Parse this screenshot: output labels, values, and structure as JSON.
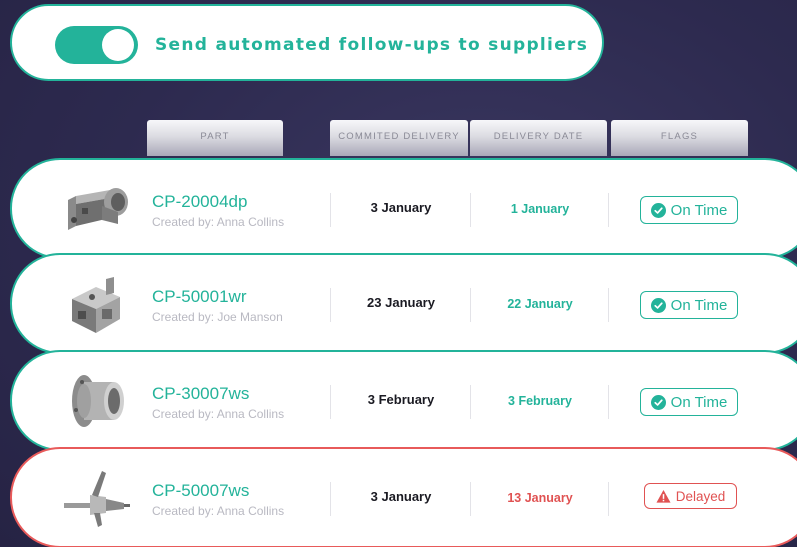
{
  "toggle": {
    "label": "Send automated follow-ups to suppliers",
    "enabled": true
  },
  "table": {
    "headers": [
      "PART",
      "COMMITED DELIVERY",
      "DELIVERY DATE",
      "FLAGS"
    ],
    "rows": [
      {
        "part_id": "CP-20004dp",
        "creator": "Created by: Anna Collins",
        "committed": "3 January",
        "delivery": "1 January",
        "flag": "On Time",
        "status": "on_time",
        "icon": "bracket-part-icon"
      },
      {
        "part_id": "CP-50001wr",
        "creator": "Created by: Joe Manson",
        "committed": "23 January",
        "delivery": "22 January",
        "flag": "On Time",
        "status": "on_time",
        "icon": "block-part-icon"
      },
      {
        "part_id": "CP-30007ws",
        "creator": "Created by: Anna Collins",
        "committed": "3 February",
        "delivery": "3 February",
        "flag": "On Time",
        "status": "on_time",
        "icon": "flange-part-icon"
      },
      {
        "part_id": "CP-50007ws",
        "creator": "Created by: Anna Collins",
        "committed": "3 January",
        "delivery": "13 January",
        "flag": "Delayed",
        "status": "delayed",
        "icon": "shaft-part-icon"
      }
    ]
  },
  "colors": {
    "accent": "#23b39a",
    "danger": "#e05252",
    "background": "#2d2a4f"
  }
}
